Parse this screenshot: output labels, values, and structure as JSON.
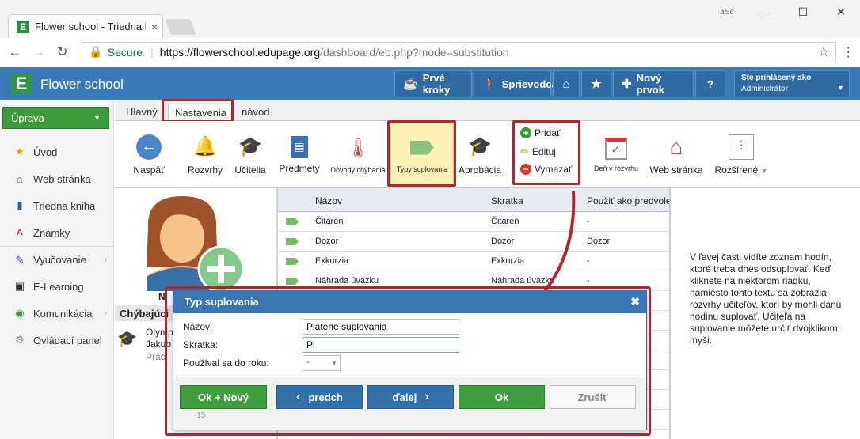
{
  "browser": {
    "tab_title": "Flower school - Triedna k",
    "tab_close": "×",
    "win_min": "—",
    "win_max": "☐",
    "win_close": "✕",
    "profile_icon": "aSc",
    "secure_label": "Secure",
    "url_host": "https://flowerschool.edupage.org",
    "url_path": "/dashboard/eb.php?mode=substitution"
  },
  "header": {
    "logo": "E",
    "app_name": "Flower school",
    "buttons": [
      "Prvé kroky",
      "Sprievodca",
      "",
      "",
      "Nový prvok",
      "?"
    ],
    "user_line1": "Ste prihlásený ako",
    "user_line2": "Administrátor"
  },
  "sidebar": {
    "mode_button": "Úprava",
    "items": [
      "Úvod",
      "Web stránka",
      "Triedna kniha",
      "Známky",
      "Vyučovanie",
      "E-Learning",
      "Komunikácia",
      "Ovládací panel"
    ]
  },
  "ribbon": {
    "tabs": [
      "Hlavný",
      "Nastavenia",
      "návod"
    ],
    "back": "Naspäť",
    "rozvrhy": "Rozvrhy",
    "ucitelia": "Učitelia",
    "predmety": "Predmety",
    "dovody": "Dôvody chýbania",
    "typy": "Typy suplovania",
    "aprobacia": "Aprobácia",
    "pridat": "Pridať",
    "edituj": "Edituj",
    "vymazat": "Vymazať",
    "den": "Deň v rozvrhu",
    "web": "Web stránka",
    "rozsirene": "Rozšírené"
  },
  "left_panel": {
    "name_fragment": "N",
    "section": "Chýbajúci",
    "teacher_line1": "Olymp",
    "teacher_line2": "Jakub",
    "teacher_line3": "Prác"
  },
  "table": {
    "headers": [
      "Názov",
      "Skratka",
      "Použiť ako predvolený"
    ],
    "rows": [
      {
        "name": "Čitáreň",
        "abbr": "Čitáreň",
        "default": "-"
      },
      {
        "name": "Dozor",
        "abbr": "Dozor",
        "default": "Dozor"
      },
      {
        "name": "Exkurzia",
        "abbr": "Exkurzia",
        "default": "-"
      },
      {
        "name": "Náhrada úväzku",
        "abbr": "Náhrada úväzku",
        "default": "-"
      }
    ]
  },
  "info_text": "V ľavej časti vidíte zoznam hodín, ktoré treba dnes odsuplovať. Keď kliknete na niektorom riadku, namiesto tohto textu sa zobrazia rozvrhy učiteľov, ktorí by mohli danú hodinu suplovať. Učiteľa na suplovanie môžete určiť dvojklikom myši.",
  "dialog": {
    "title": "Typ suplovania",
    "close": "✖",
    "label_nazov": "Názov:",
    "label_skratka": "Skratka:",
    "label_rok": "Používal sa do roku:",
    "value_nazov": "Platené suplovania",
    "value_skratka": "Pl",
    "value_rok": "-",
    "btn_ok_new": "Ok + Nový",
    "btn_prev": "predch",
    "btn_next": "ďalej",
    "btn_ok": "Ok",
    "btn_cancel": "Zrušiť",
    "counter": "-15"
  },
  "colors": {
    "accent_blue": "#3b7ab8",
    "green": "#3f9f3f",
    "highlight_red": "#b3262e"
  }
}
